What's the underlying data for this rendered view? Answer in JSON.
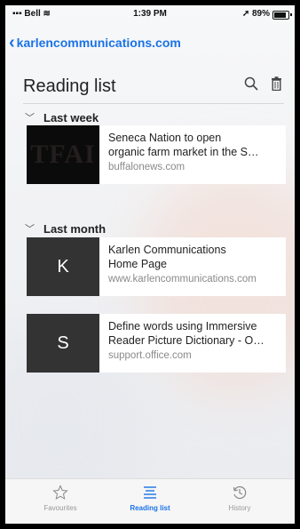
{
  "status_bar": {
    "carrier": "Bell",
    "time": "1:39 PM",
    "battery": "89%"
  },
  "nav": {
    "back_label": "karlencommunications.com"
  },
  "header": {
    "title": "Reading list"
  },
  "sections": [
    {
      "label": "Last week",
      "items": [
        {
          "thumb": "TFAI",
          "line1": "Seneca Nation to open",
          "line2": "organic farm market in the S…",
          "source": "buffalonews.com"
        }
      ]
    },
    {
      "label": "Last month",
      "items": [
        {
          "thumb": "K",
          "line1": "Karlen Communications",
          "line2": "Home Page",
          "source": "www.karlencommunications.com"
        },
        {
          "thumb": "S",
          "line1": "Define words using Immersive",
          "line2": "Reader Picture Dictionary - O…",
          "source": "support.office.com"
        }
      ]
    }
  ],
  "tabs": [
    {
      "label": "Favourites",
      "icon": "star-icon",
      "active": false
    },
    {
      "label": "Reading list",
      "icon": "reading-list-icon",
      "active": true
    },
    {
      "label": "History",
      "icon": "history-icon",
      "active": false
    }
  ],
  "colors": {
    "accent": "#1a73e8"
  }
}
